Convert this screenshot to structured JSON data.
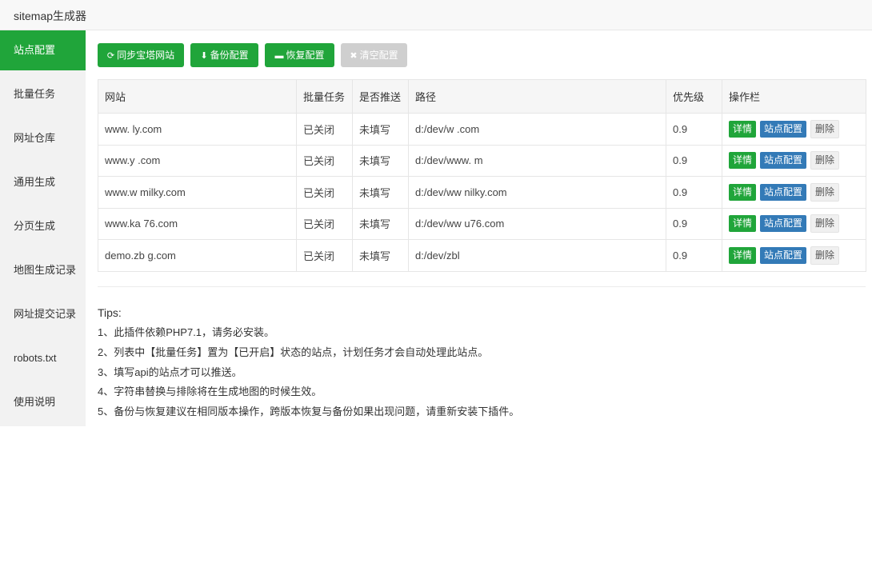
{
  "window": {
    "title": "sitemap生成器"
  },
  "sidebar": {
    "items": [
      {
        "label": "站点配置",
        "active": true
      },
      {
        "label": "批量任务"
      },
      {
        "label": "网址仓库"
      },
      {
        "label": "通用生成"
      },
      {
        "label": "分页生成"
      },
      {
        "label": "地图生成记录"
      },
      {
        "label": "网址提交记录"
      },
      {
        "label": "robots.txt"
      },
      {
        "label": "使用说明"
      }
    ]
  },
  "toolbar": {
    "sync_label": "同步宝塔网站",
    "backup_label": "备份配置",
    "restore_label": "恢复配置",
    "clear_label": "清空配置"
  },
  "table": {
    "headers": [
      "网站",
      "批量任务",
      "是否推送",
      "路径",
      "优先级",
      "操作栏"
    ],
    "rows": [
      {
        "site": "www.        ly.com",
        "batch": "已关闭",
        "push": "未填写",
        "path": "d:/dev/w            .com",
        "priority": "0.9"
      },
      {
        "site": "www.y       .com",
        "batch": "已关闭",
        "push": "未填写",
        "path": "d:/dev/www.             m",
        "priority": "0.9"
      },
      {
        "site": "www.w       milky.com",
        "batch": "已关闭",
        "push": "未填写",
        "path": "d:/dev/ww              nilky.com",
        "priority": "0.9"
      },
      {
        "site": "www.ka        76.com",
        "batch": "已关闭",
        "push": "未填写",
        "path": "d:/dev/ww              u76.com",
        "priority": "0.9"
      },
      {
        "site": "demo.zb       g.com",
        "batch": "已关闭",
        "push": "未填写",
        "path": "d:/dev/zbl",
        "priority": "0.9"
      }
    ],
    "actions": {
      "detail": "详情",
      "config": "站点配置",
      "delete": "删除"
    }
  },
  "tips": {
    "title": "Tips:",
    "lines": [
      "1、此插件依赖PHP7.1，请务必安装。",
      "2、列表中【批量任务】置为【已开启】状态的站点，计划任务才会自动处理此站点。",
      "3、填写api的站点才可以推送。",
      "4、字符串替换与排除将在生成地图的时候生效。",
      "5、备份与恢复建议在相同版本操作，跨版本恢复与备份如果出现问题，请重新安装下插件。"
    ]
  },
  "colors": {
    "primary": "#20a53a",
    "config_button": "#337ab7",
    "status_off": "#e0231e"
  }
}
